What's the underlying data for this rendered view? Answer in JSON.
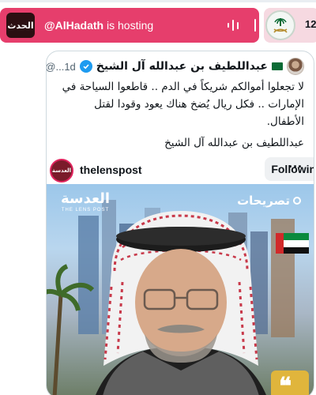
{
  "progress": {
    "fraction": 0.0
  },
  "spaces_bar": {
    "host_logo_text": "الحدث",
    "host_handle": "@AlHadath",
    "hosting_suffix": " is hosting",
    "audio_icon": "audio-wave-icon"
  },
  "next_space": {
    "count_label": "12"
  },
  "quote": {
    "author_name": "عبداللطيف بن عبدالله آل الشيخ",
    "meta": "@...1d",
    "text": "لا تجعلوا أموالكم شريكاً في الدم .. قاطعوا السياحة في الإمارات .. فكل ريال يُضخ هناك يعود وقودا لقتل الأطفال.",
    "signature": "عبداللطيف بن عبدالله آل الشيخ"
  },
  "embed": {
    "avatar_text": "العدسة",
    "account_name": "thelenspost",
    "follow_label": "Following",
    "more_label": "···"
  },
  "photo": {
    "logo_text": "العدسة",
    "logo_sub": "THE LENS POST",
    "tag_text": "تصريحات"
  },
  "colors": {
    "spaces_bar": "#e63e6c",
    "verified": "#1d9bf0",
    "card_border": "#cfd9de",
    "text_secondary": "#536471"
  }
}
